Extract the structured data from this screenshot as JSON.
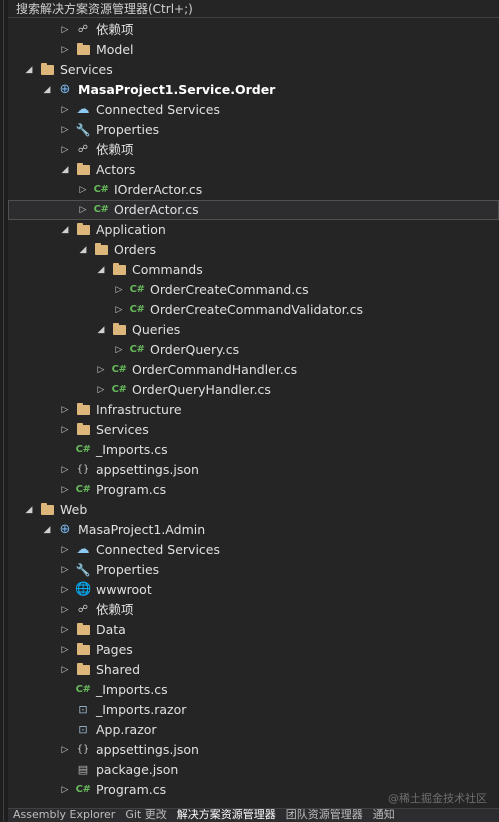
{
  "search": {
    "placeholder": "搜索解决方案资源管理器(Ctrl+;)"
  },
  "tree": [
    {
      "depth": 3,
      "expand": "collapsed",
      "icon": "dependencies-icon",
      "label": "依赖项"
    },
    {
      "depth": 3,
      "expand": "collapsed",
      "icon": "folder-icon",
      "label": "Model"
    },
    {
      "depth": 1,
      "expand": "expanded",
      "icon": "folder-icon",
      "label": "Services"
    },
    {
      "depth": 2,
      "expand": "expanded",
      "icon": "project-icon",
      "label": "MasaProject1.Service.Order",
      "bold": true
    },
    {
      "depth": 3,
      "expand": "collapsed",
      "icon": "connected-services-icon",
      "label": "Connected Services"
    },
    {
      "depth": 3,
      "expand": "collapsed",
      "icon": "properties-icon",
      "label": "Properties"
    },
    {
      "depth": 3,
      "expand": "collapsed",
      "icon": "dependencies-icon",
      "label": "依赖项"
    },
    {
      "depth": 3,
      "expand": "expanded",
      "icon": "folder-icon",
      "label": "Actors"
    },
    {
      "depth": 4,
      "expand": "collapsed",
      "icon": "csharp-file-icon",
      "label": "IOrderActor.cs"
    },
    {
      "depth": 4,
      "expand": "collapsed",
      "icon": "csharp-file-icon",
      "label": "OrderActor.cs",
      "selected": true
    },
    {
      "depth": 3,
      "expand": "expanded",
      "icon": "folder-icon",
      "label": "Application"
    },
    {
      "depth": 4,
      "expand": "expanded",
      "icon": "folder-icon",
      "label": "Orders"
    },
    {
      "depth": 5,
      "expand": "expanded",
      "icon": "folder-icon",
      "label": "Commands"
    },
    {
      "depth": 6,
      "expand": "collapsed",
      "icon": "csharp-file-icon",
      "label": "OrderCreateCommand.cs"
    },
    {
      "depth": 6,
      "expand": "collapsed",
      "icon": "csharp-file-icon",
      "label": "OrderCreateCommandValidator.cs"
    },
    {
      "depth": 5,
      "expand": "expanded",
      "icon": "folder-icon",
      "label": "Queries"
    },
    {
      "depth": 6,
      "expand": "collapsed",
      "icon": "csharp-file-icon",
      "label": "OrderQuery.cs"
    },
    {
      "depth": 5,
      "expand": "collapsed",
      "icon": "csharp-file-icon",
      "label": "OrderCommandHandler.cs"
    },
    {
      "depth": 5,
      "expand": "collapsed",
      "icon": "csharp-file-icon",
      "label": "OrderQueryHandler.cs"
    },
    {
      "depth": 3,
      "expand": "collapsed",
      "icon": "folder-icon",
      "label": "Infrastructure"
    },
    {
      "depth": 3,
      "expand": "collapsed",
      "icon": "folder-icon",
      "label": "Services"
    },
    {
      "depth": 3,
      "expand": "none",
      "icon": "csharp-file-icon",
      "label": "_Imports.cs"
    },
    {
      "depth": 3,
      "expand": "collapsed",
      "icon": "json-file-icon",
      "label": "appsettings.json"
    },
    {
      "depth": 3,
      "expand": "collapsed",
      "icon": "csharp-file-icon",
      "label": "Program.cs"
    },
    {
      "depth": 1,
      "expand": "expanded",
      "icon": "folder-icon",
      "label": "Web"
    },
    {
      "depth": 2,
      "expand": "expanded",
      "icon": "project-icon",
      "label": "MasaProject1.Admin"
    },
    {
      "depth": 3,
      "expand": "collapsed",
      "icon": "connected-services-icon",
      "label": "Connected Services"
    },
    {
      "depth": 3,
      "expand": "collapsed",
      "icon": "properties-icon",
      "label": "Properties"
    },
    {
      "depth": 3,
      "expand": "collapsed",
      "icon": "globe-icon",
      "label": "wwwroot"
    },
    {
      "depth": 3,
      "expand": "collapsed",
      "icon": "dependencies-icon",
      "label": "依赖项"
    },
    {
      "depth": 3,
      "expand": "collapsed",
      "icon": "folder-icon",
      "label": "Data"
    },
    {
      "depth": 3,
      "expand": "collapsed",
      "icon": "folder-icon",
      "label": "Pages"
    },
    {
      "depth": 3,
      "expand": "collapsed",
      "icon": "folder-icon",
      "label": "Shared"
    },
    {
      "depth": 3,
      "expand": "none",
      "icon": "csharp-file-icon",
      "label": "_Imports.cs"
    },
    {
      "depth": 3,
      "expand": "none",
      "icon": "razor-file-icon",
      "label": "_Imports.razor"
    },
    {
      "depth": 3,
      "expand": "none",
      "icon": "razor-file-icon",
      "label": "App.razor"
    },
    {
      "depth": 3,
      "expand": "collapsed",
      "icon": "json-file-icon",
      "label": "appsettings.json"
    },
    {
      "depth": 3,
      "expand": "none",
      "icon": "package-json-icon",
      "label": "package.json"
    },
    {
      "depth": 3,
      "expand": "collapsed",
      "icon": "csharp-file-icon",
      "label": "Program.cs"
    }
  ],
  "icons": {
    "csharp-file-icon": "C#",
    "project-icon": "⊕",
    "connected-services-icon": "☁",
    "properties-icon": "🔧",
    "dependencies-icon": "☍",
    "json-file-icon": "{}",
    "razor-file-icon": "⊡",
    "globe-icon": "🌐",
    "package-json-icon": "▤",
    "folder-icon": ""
  },
  "carets": {
    "collapsed": "▷",
    "expanded": "◢",
    "none": ""
  },
  "tabs": [
    "Assembly Explorer",
    "Git 更改",
    "解决方案资源管理器",
    "团队资源管理器",
    "通知"
  ],
  "watermark": "@稀土掘金技术社区",
  "colors": {
    "background": "#252526",
    "folder": "#dcb67a",
    "csharp": "#68b95b",
    "selected_row": "#2d2d30"
  }
}
